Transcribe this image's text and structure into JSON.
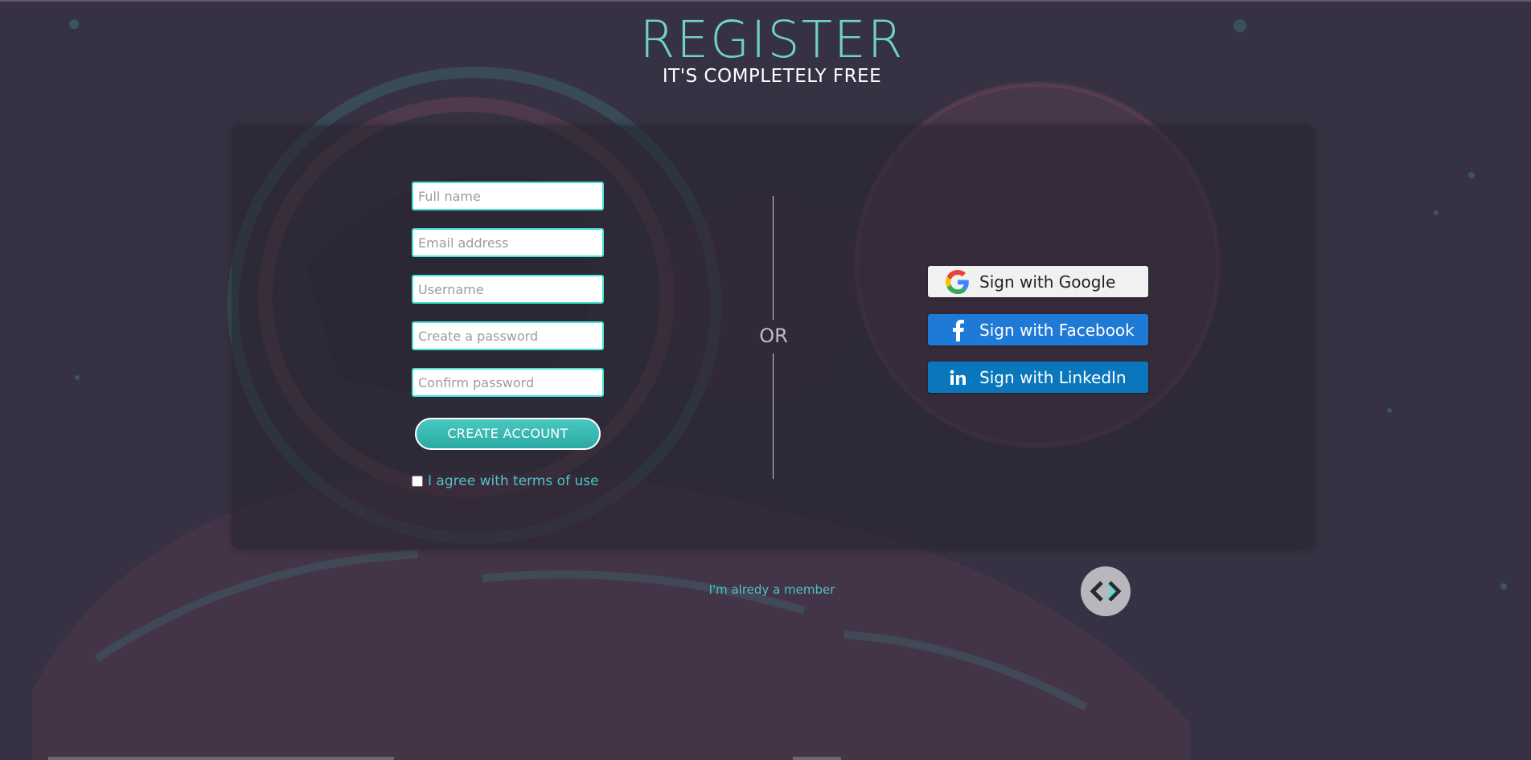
{
  "header": {
    "title": "REGISTER",
    "subtitle": "IT'S COMPLETELY FREE"
  },
  "form": {
    "full_name_placeholder": "Full name",
    "email_placeholder": "Email address",
    "username_placeholder": "Username",
    "password_placeholder": "Create a password",
    "confirm_password_placeholder": "Confirm password",
    "create_account_label": "CREATE ACCOUNT",
    "terms_label": "I agree with terms of use",
    "terms_checked": false
  },
  "divider": {
    "label": "OR"
  },
  "social": {
    "google_label": "Sign with Google",
    "facebook_label": "Sign with Facebook",
    "linkedin_label": "Sign with LinkedIn"
  },
  "footer": {
    "member_link": "I'm alredy a member",
    "badge_icon": "code-brackets-icon"
  },
  "colors": {
    "background": "#373243",
    "accent": "#49e0d6",
    "title": "#6fd3c6",
    "facebook": "#1e7ad6",
    "linkedin": "#0a77bd"
  }
}
